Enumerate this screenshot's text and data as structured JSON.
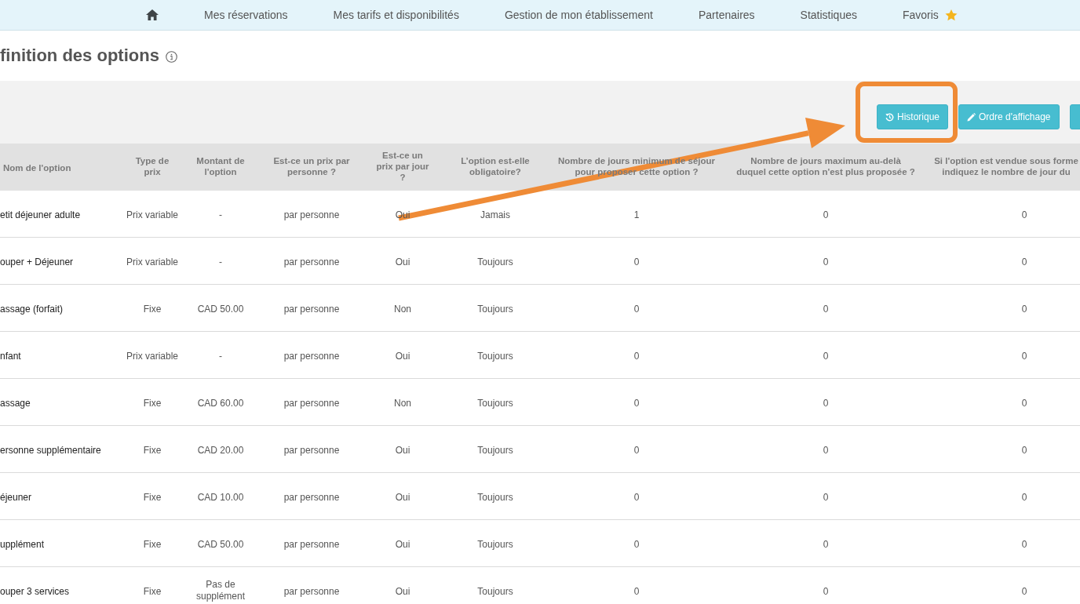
{
  "nav": {
    "items": [
      {
        "kind": "home"
      },
      {
        "kind": "link",
        "label": "Mes réservations"
      },
      {
        "kind": "link",
        "label": "Mes tarifs et disponibilités"
      },
      {
        "kind": "link",
        "label": "Gestion de mon établissement"
      },
      {
        "kind": "link",
        "label": "Partenaires"
      },
      {
        "kind": "link",
        "label": "Statistiques"
      },
      {
        "kind": "starred",
        "label": "Favoris"
      }
    ]
  },
  "page": {
    "title": "finition des options"
  },
  "toolbar": {
    "buttons": [
      {
        "kind": "history",
        "label": "Historique",
        "highlighted": true
      },
      {
        "kind": "edit",
        "label": "Ordre d'affichage"
      },
      {
        "kind": "plain"
      }
    ]
  },
  "table": {
    "columns": [
      "Nom de l'option",
      "Type de prix",
      "Montant de l'option",
      "Est-ce un prix par personne ?",
      "Est-ce un prix par jour ?",
      "L’option est-elle obligatoire?",
      "Nombre de jours minimum de séjour pour proposer cette option ?",
      "Nombre de jours maximum au-delà duquel cette option n'est plus proposée ?",
      "Si l'option est vendue sous forme indiquez le nombre de jour du"
    ],
    "rows": [
      [
        "etit déjeuner adulte",
        "Prix variable",
        "-",
        "par personne",
        "Oui",
        "Jamais",
        "1",
        "0",
        "0"
      ],
      [
        "ouper + Déjeuner",
        "Prix variable",
        "-",
        "par personne",
        "Oui",
        "Toujours",
        "0",
        "0",
        "0"
      ],
      [
        "assage (forfait)",
        "Fixe",
        "CAD 50.00",
        "par personne",
        "Non",
        "Toujours",
        "0",
        "0",
        "0"
      ],
      [
        "nfant",
        "Prix variable",
        "-",
        "par personne",
        "Oui",
        "Toujours",
        "0",
        "0",
        "0"
      ],
      [
        "assage",
        "Fixe",
        "CAD 60.00",
        "par personne",
        "Non",
        "Toujours",
        "0",
        "0",
        "0"
      ],
      [
        "ersonne supplémentaire",
        "Fixe",
        "CAD 20.00",
        "par personne",
        "Oui",
        "Toujours",
        "0",
        "0",
        "0"
      ],
      [
        "éjeuner",
        "Fixe",
        "CAD 10.00",
        "par personne",
        "Oui",
        "Toujours",
        "0",
        "0",
        "0"
      ],
      [
        "upplément",
        "Fixe",
        "CAD 50.00",
        "par personne",
        "Oui",
        "Toujours",
        "0",
        "0",
        "0"
      ],
      [
        "ouper 3 services",
        "Fixe",
        "Pas de supplément",
        "par personne",
        "Oui",
        "Toujours",
        "0",
        "0",
        "0"
      ]
    ]
  }
}
